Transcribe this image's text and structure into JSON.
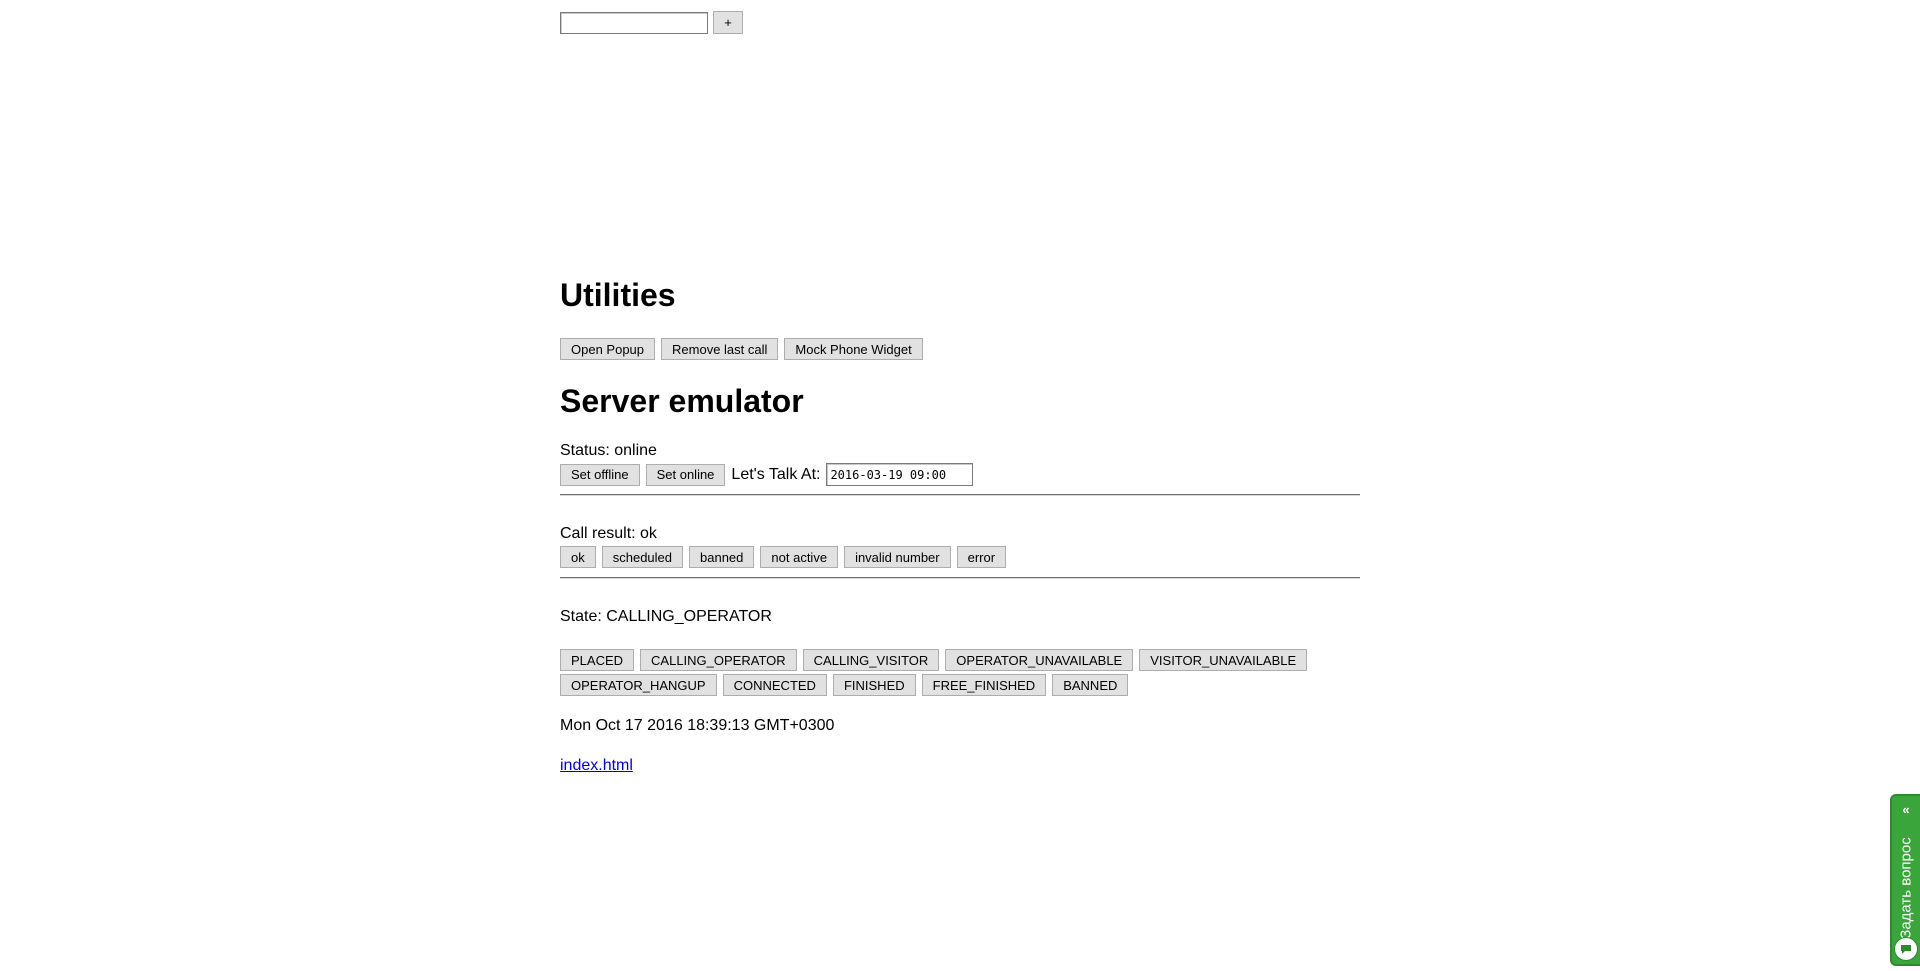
{
  "top": {
    "input_value": "",
    "add_label": "+"
  },
  "utilities": {
    "heading": "Utilities",
    "buttons": [
      "Open Popup",
      "Remove last call",
      "Mock Phone Widget"
    ]
  },
  "server": {
    "heading": "Server emulator",
    "status_text": "Status: online",
    "set_offline": "Set offline",
    "set_online": "Set online",
    "lets_talk_label": "Let's Talk At:",
    "lets_talk_value": "2016-03-19 09:00",
    "call_result_text": "Call result: ok",
    "call_results": [
      "ok",
      "scheduled",
      "banned",
      "not active",
      "invalid number",
      "error"
    ],
    "state_text": "State: CALLING_OPERATOR",
    "states_row1": [
      "PLACED",
      "CALLING_OPERATOR",
      "CALLING_VISITOR",
      "OPERATOR_UNAVAILABLE",
      "VISITOR_UNAVAILABLE"
    ],
    "states_row2": [
      "OPERATOR_HANGUP",
      "CONNECTED",
      "FINISHED",
      "FREE_FINISHED",
      "BANNED"
    ],
    "datetime": "Mon Oct 17 2016 18:39:13 GMT+0300",
    "link": "index.html"
  },
  "feedback": {
    "label": "Задать вопрос",
    "arrows": "«",
    "color": "#3aa53a",
    "icon": "chat-bubble-icon"
  }
}
